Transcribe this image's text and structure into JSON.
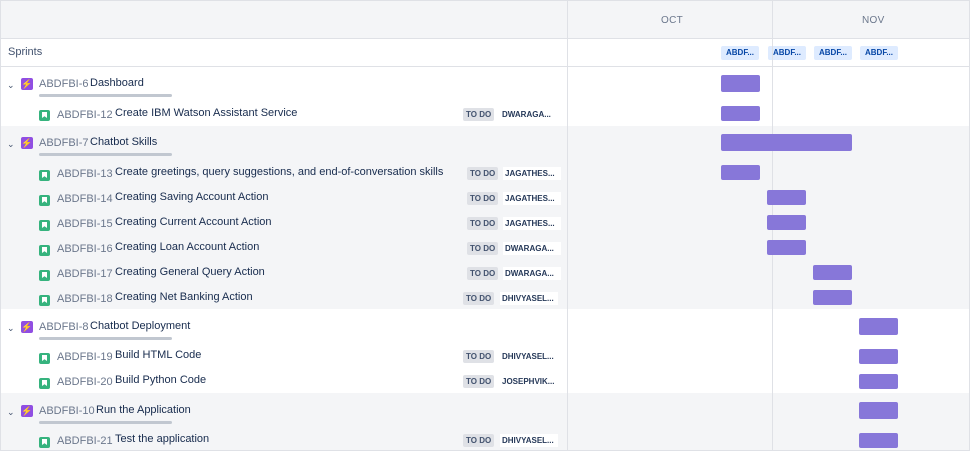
{
  "timeline": {
    "months": [
      "OCT",
      "NOV"
    ],
    "sprints_label": "Sprints",
    "sprint_chips": [
      "ABDF...",
      "ABDF...",
      "ABDF...",
      "ABDF..."
    ]
  },
  "epics": [
    {
      "key": "ABDFBI-6",
      "summary": "Dashboard",
      "children": [
        {
          "key": "ABDFBI-12",
          "summary": "Create IBM Watson Assistant Service",
          "status": "TO DO",
          "assignee": "DWARAGA..."
        }
      ]
    },
    {
      "key": "ABDFBI-7",
      "summary": "Chatbot Skills",
      "children": [
        {
          "key": "ABDFBI-13",
          "summary": "Create greetings, query suggestions, and end-of-conversation skills",
          "status": "TO DO",
          "assignee": "JAGATHES..."
        },
        {
          "key": "ABDFBI-14",
          "summary": "Creating Saving Account Action",
          "status": "TO DO",
          "assignee": "JAGATHES..."
        },
        {
          "key": "ABDFBI-15",
          "summary": "Creating Current Account Action",
          "status": "TO DO",
          "assignee": "JAGATHES..."
        },
        {
          "key": "ABDFBI-16",
          "summary": "Creating Loan Account Action",
          "status": "TO DO",
          "assignee": "DWARAGA..."
        },
        {
          "key": "ABDFBI-17",
          "summary": "Creating General Query Action",
          "status": "TO DO",
          "assignee": "DWARAGA..."
        },
        {
          "key": "ABDFBI-18",
          "summary": "Creating Net Banking Action",
          "status": "TO DO",
          "assignee": "DHIVYASEL..."
        }
      ]
    },
    {
      "key": "ABDFBI-8",
      "summary": "Chatbot Deployment",
      "children": [
        {
          "key": "ABDFBI-19",
          "summary": "Build HTML Code",
          "status": "TO DO",
          "assignee": "DHIVYASEL..."
        },
        {
          "key": "ABDFBI-20",
          "summary": "Build Python Code",
          "status": "TO DO",
          "assignee": "JOSEPHVIK..."
        }
      ]
    },
    {
      "key": "ABDFBI-10",
      "summary": "Run the Application",
      "children": [
        {
          "key": "ABDFBI-21",
          "summary": "Test the application",
          "status": "TO DO",
          "assignee": "DHIVYASEL..."
        }
      ]
    }
  ],
  "colors": {
    "bar": "#8777d9",
    "epic_icon": "#904ee2",
    "story_icon": "#36b37e",
    "sprint_chip": "#deebff"
  }
}
